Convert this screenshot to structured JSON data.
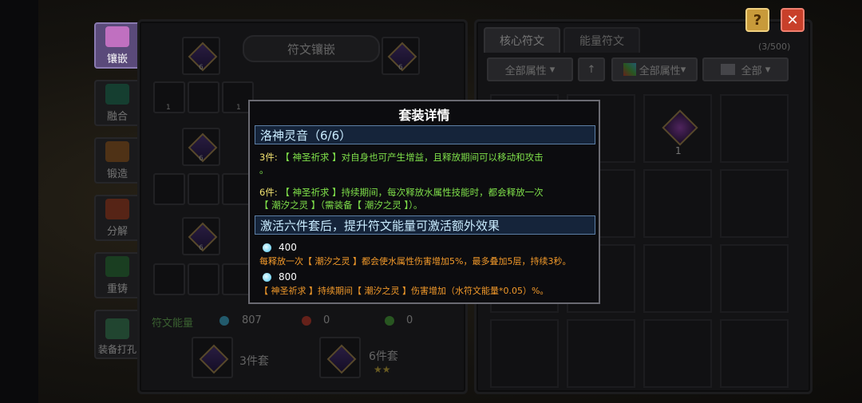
{
  "side_tabs": [
    "镶嵌",
    "融合",
    "锻造",
    "分解",
    "重铸",
    "装备打孔"
  ],
  "left_panel": {
    "title": "符文镶嵌",
    "slot_counts": [
      "6",
      "6",
      "1",
      "1",
      "6",
      "6",
      "6"
    ],
    "energy_label": "符文能量",
    "energy_values": [
      "807",
      "0",
      "0"
    ],
    "set_3_label": "3件套",
    "set_6_label": "6件套",
    "set_6_stars": "★★"
  },
  "right_panel": {
    "tabs": [
      "核心符文",
      "能量符文"
    ],
    "count": "(3/500)",
    "filters": [
      "全部属性",
      "全部属性",
      "全部"
    ],
    "sort_arrow": "↑",
    "item_count": "1"
  },
  "corner": {
    "help": "?",
    "close": "✕"
  },
  "modal": {
    "title": "套装详情",
    "set_name": "洛神灵音（6/6）",
    "line1_count": "3件:",
    "line1_text": "【 神圣祈求 】对自身也可产生增益，且释放期间可以移动和攻击",
    "line1_cont": "。",
    "line2_count": "6件:",
    "line2_text": "【 神圣祈求 】持续期间，每次释放水属性技能时，都会释放一次",
    "line2_cont": "【 潮汐之灵 】（需装备【 潮汐之灵 】）。",
    "extra_header": "激活六件套后，提升符文能量可激活额外效果",
    "tier1_value": "400",
    "tier1_text": "每释放一次【 潮汐之灵 】都会使水属性伤害增加5%，最多叠加5层，持续3秒。",
    "tier2_value": "800",
    "tier2_text": "【 神圣祈求 】持续期间【 潮汐之灵 】伤害增加（水符文能量*0.05）%。"
  }
}
